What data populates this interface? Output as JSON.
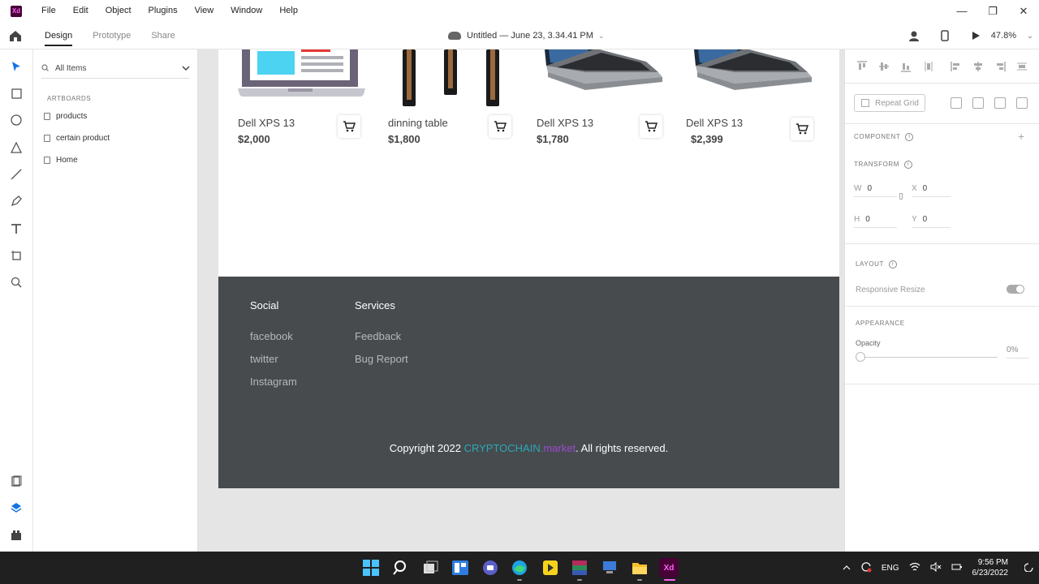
{
  "app": {
    "logo_text": "Xd"
  },
  "menubar": {
    "items": [
      "File",
      "Edit",
      "Object",
      "Plugins",
      "View",
      "Window",
      "Help"
    ]
  },
  "window_controls": {
    "minimize": "—",
    "maximize": "❐",
    "close": "✕"
  },
  "toolbar": {
    "tabs": [
      "Design",
      "Prototype",
      "Share"
    ],
    "active_tab": "Design",
    "document_title": "Untitled — June 23, 3.34.41 PM",
    "zoom": "47.8%"
  },
  "layers": {
    "filter_label": "All Items",
    "section_title": "ARTBOARDS",
    "artboards": [
      "products",
      "certain product",
      "Home"
    ]
  },
  "products": [
    {
      "name": "Dell XPS 13",
      "price": "$2,000",
      "image": "laptop-illustration"
    },
    {
      "name": "dinning table",
      "price": "$1,800",
      "image": "table-legs"
    },
    {
      "name": "Dell XPS 13",
      "price": "$1,780",
      "image": "laptop-photo"
    },
    {
      "name": "Dell XPS 13",
      "price": "$2,399",
      "image": "laptop-photo"
    }
  ],
  "footer": {
    "columns": [
      {
        "title": "Social",
        "links": [
          "facebook",
          "twitter",
          "Instagram"
        ]
      },
      {
        "title": "Services",
        "links": [
          "Feedback",
          "Bug Report"
        ]
      }
    ],
    "copyright_prefix": "Copyright 2022 ",
    "brand_part1": "CRYPTOCHAIN",
    "brand_part2": ".market",
    "copyright_suffix": ". All rights reserved.",
    "colors": {
      "background": "#474b4e",
      "brand1": "#2aa8b8",
      "brand2": "#9c4bd1"
    }
  },
  "properties": {
    "repeat_grid": "Repeat Grid",
    "component_label": "COMPONENT",
    "transform_label": "TRANSFORM",
    "w_label": "W",
    "w_value": "0",
    "x_label": "X",
    "x_value": "0",
    "h_label": "H",
    "h_value": "0",
    "y_label": "Y",
    "y_value": "0",
    "layout_label": "LAYOUT",
    "responsive_resize": "Responsive Resize",
    "appearance_label": "APPEARANCE",
    "opacity_label": "Opacity",
    "opacity_value": "0%"
  },
  "taskbar": {
    "language": "ENG",
    "time": "9:56 PM",
    "date": "6/23/2022"
  }
}
